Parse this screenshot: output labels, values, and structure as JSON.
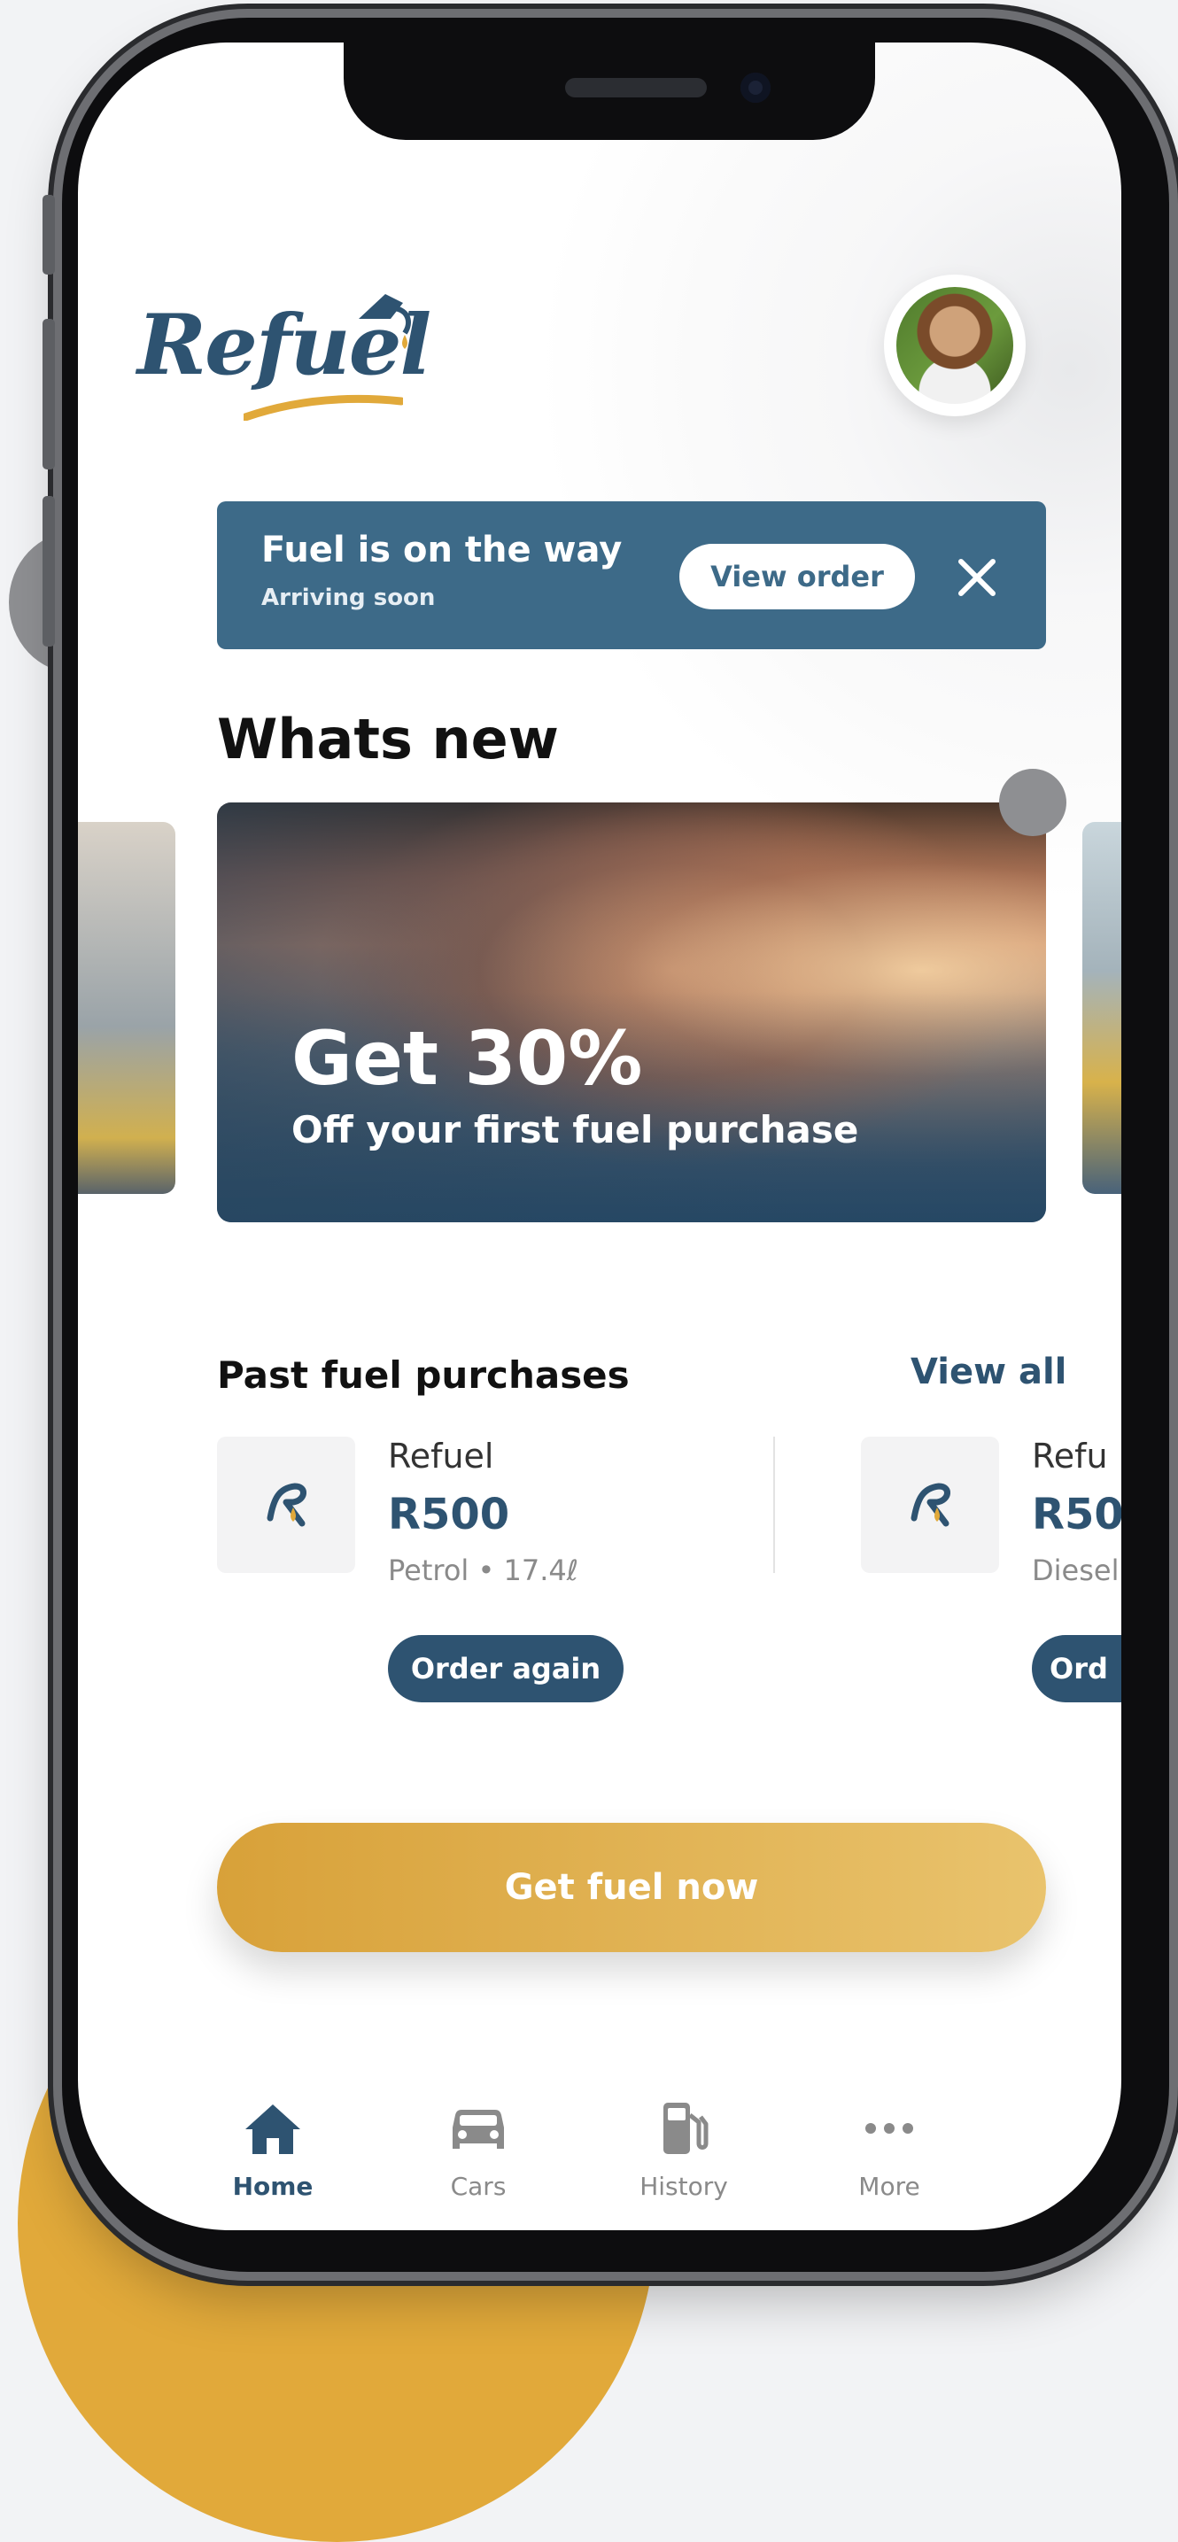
{
  "app": {
    "logo_text": "Refuel"
  },
  "banner": {
    "title": "Fuel is on the way",
    "subtitle": "Arriving soon",
    "action_label": "View order",
    "close_icon": "close-icon"
  },
  "whats_new": {
    "title": "Whats new",
    "promo_title": "Get 30%",
    "promo_subtitle": "Off your first fuel purchase"
  },
  "past_purchases": {
    "title": "Past fuel purchases",
    "view_all_label": "View all",
    "items": [
      {
        "vendor": "Refuel",
        "amount": "R500",
        "meta": "Petrol • 17.4ℓ",
        "action_label": "Order again"
      },
      {
        "vendor": "Refu",
        "amount": "R50",
        "meta": "Diesel",
        "action_label": "Ord"
      }
    ]
  },
  "cta": {
    "label": "Get fuel now"
  },
  "tabs": [
    {
      "label": "Home",
      "icon": "home-icon",
      "active": true
    },
    {
      "label": "Cars",
      "icon": "car-icon",
      "active": false
    },
    {
      "label": "History",
      "icon": "fuel-pump-icon",
      "active": false
    },
    {
      "label": "More",
      "icon": "more-dots-icon",
      "active": false
    }
  ],
  "colors": {
    "primary": "#2e5371",
    "banner": "#3d6a88",
    "accent_gold": "#e1a93a"
  }
}
